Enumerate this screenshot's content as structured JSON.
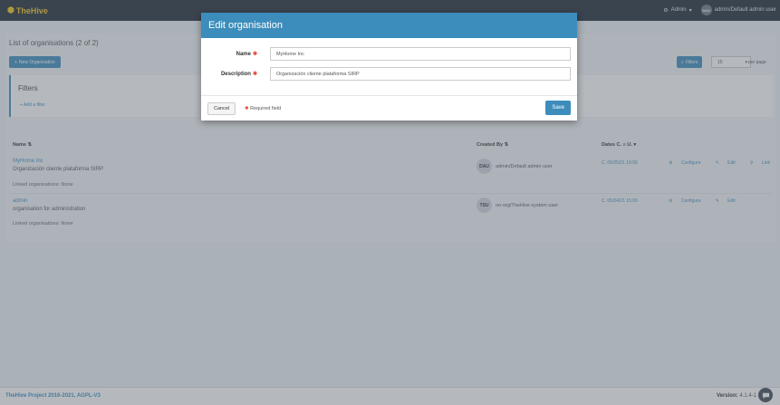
{
  "navbar": {
    "brand": "TheHive",
    "admin_menu": "Admin",
    "user_initials": "DAU",
    "user_label": "admin/Default admin user"
  },
  "list": {
    "title": "List of organisations (2 of 2)",
    "new_button": "New Organisation",
    "filters_button": "Filters",
    "page_size": "15",
    "per_page_label": "per page",
    "filters_title": "Filters",
    "add_filter": "Add a filter",
    "columns": {
      "name": "Name",
      "created_by": "Created By",
      "dates": "Dates",
      "dates_sort": "C. ≡ U."
    },
    "rows": [
      {
        "name": "MyHome Inc",
        "description": "Organización cliente plataforma SIRP",
        "linked": "Linked organisations: None",
        "creator_initials": "DAU",
        "creator": "admin/Default admin user",
        "date": "C. 05/05/21 19:56",
        "actions": [
          "Configure",
          "Edit",
          "Link"
        ]
      },
      {
        "name": "admin",
        "description": "organisation for administration",
        "linked": "Linked organisations: None",
        "creator_initials": "TSU",
        "creator": "no-org/TheHive system user",
        "date": "C. 05/04/21 15:09",
        "actions": [
          "Configure",
          "Edit"
        ]
      }
    ]
  },
  "modal": {
    "title": "Edit organisation",
    "name_label": "Name",
    "name_value": "MyHome Inc",
    "description_label": "Description",
    "description_value": "Organización cliente plataforma SIRP",
    "cancel": "Cancel",
    "required_note": "Required field",
    "save": "Save"
  },
  "footer": {
    "copyright": "TheHive Project 2016-2021, AGPL-V3",
    "version_label": "Version:",
    "version": "4.1.4-1"
  },
  "colors": {
    "primary": "#3c8dbc",
    "navbar": "#1f2a36",
    "required": "#dd4b39"
  }
}
